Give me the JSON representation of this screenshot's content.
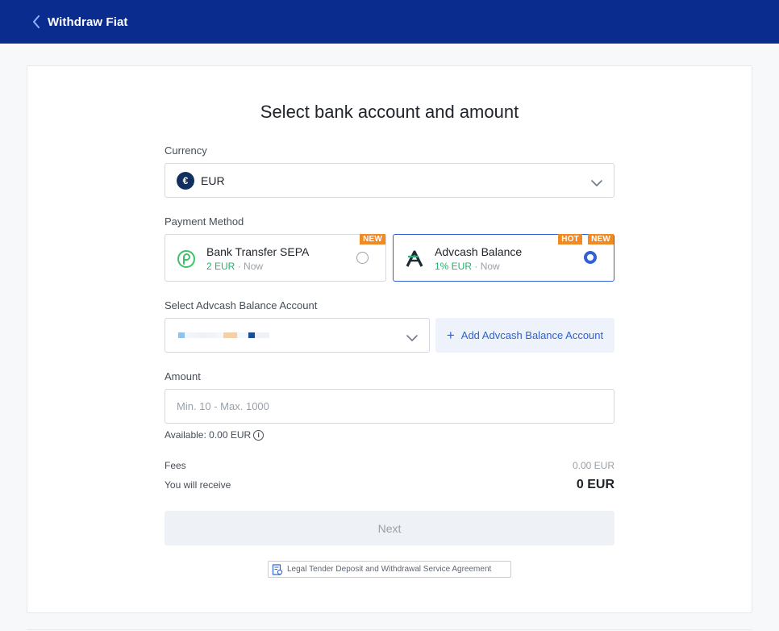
{
  "header": {
    "title": "Withdraw Fiat"
  },
  "page_title": "Select bank account and amount",
  "currency": {
    "label": "Currency",
    "value": "EUR",
    "symbol": "€"
  },
  "payment_method": {
    "label": "Payment Method",
    "options": [
      {
        "name": "Bank Transfer SEPA",
        "fee": "2 EUR",
        "separator": "·",
        "time": "Now",
        "badges": [
          "NEW"
        ],
        "selected": false
      },
      {
        "name": "Advcash Balance",
        "fee": "1% EUR",
        "separator": "·",
        "time": "Now",
        "badges": [
          "HOT",
          "NEW"
        ],
        "selected": true
      }
    ]
  },
  "account": {
    "label": "Select Advcash Balance Account",
    "add_label": "Add Advcash Balance Account"
  },
  "amount": {
    "label": "Amount",
    "placeholder": "Min. 10 - Max. 1000",
    "available": "Available: 0.00 EUR"
  },
  "fees": {
    "label": "Fees",
    "value": "0.00 EUR"
  },
  "receive": {
    "label": "You will receive",
    "value": "0 EUR"
  },
  "next_label": "Next",
  "agreement_label": "Legal Tender Deposit and Withdrawal Service Agreement",
  "colors": {
    "header_bg": "#0a2c8f",
    "accent": "#2e62d6",
    "fee_green": "#21b36a",
    "badge_orange": "#f08a24"
  }
}
